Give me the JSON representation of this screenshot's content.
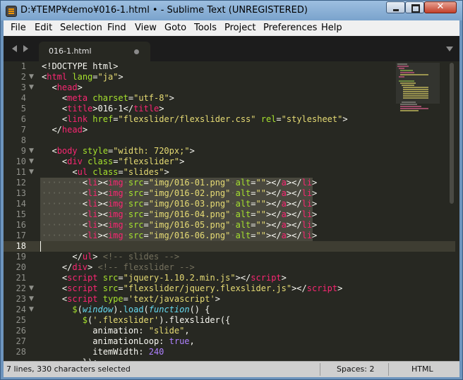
{
  "window": {
    "title": "D:¥TEMP¥demo¥016-1.html • - Sublime Text (UNREGISTERED)",
    "minimize_icon": "minimize-icon",
    "maximize_icon": "maximize-icon",
    "close_label": "✕"
  },
  "menu": [
    "File",
    "Edit",
    "Selection",
    "Find",
    "View",
    "Goto",
    "Tools",
    "Project",
    "Preferences",
    "Help"
  ],
  "tabs": [
    {
      "label": "016-1.html",
      "dirty_icon": "unsaved-dot-icon"
    }
  ],
  "editor": {
    "current_line": 18,
    "line_numbers": [
      "1",
      "2",
      "3",
      "4",
      "5",
      "6",
      "7",
      "8",
      "9",
      "10",
      "11",
      "12",
      "13",
      "14",
      "15",
      "16",
      "17",
      "18",
      "19",
      "20",
      "21",
      "22",
      "23",
      "24",
      "25",
      "26",
      "27",
      "28"
    ],
    "fold_lines": [
      "2",
      "3",
      "9",
      "10",
      "11",
      "22",
      "23",
      "24"
    ],
    "selected_lines": [
      "12",
      "13",
      "14",
      "15",
      "16",
      "17"
    ]
  },
  "status": {
    "selection": "7 lines, 330 characters selected",
    "spaces": "Spaces: 2",
    "syntax": "HTML"
  },
  "colors": {
    "background": "#272822",
    "tag": "#f92672",
    "attribute": "#a6e22e",
    "string": "#e6db74",
    "comment": "#75715e",
    "keyword": "#66d9ef",
    "number": "#ae81ff",
    "selection": "#49483e"
  }
}
